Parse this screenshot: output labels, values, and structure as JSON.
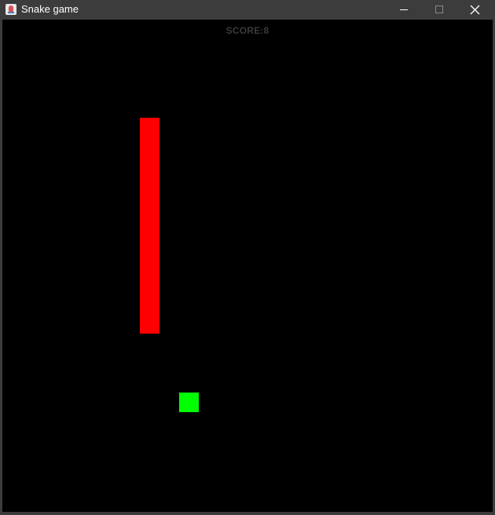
{
  "window": {
    "title": "Snake game",
    "icon": "java-cup-icon",
    "controls": [
      "minimize-icon",
      "maximize-icon",
      "close-icon"
    ]
  },
  "game": {
    "score_text": "SCORE:8",
    "background_color": "#000000",
    "snake_color": "#ff0000",
    "food_color": "#00ff00",
    "score_color": "#3a3a3a"
  }
}
